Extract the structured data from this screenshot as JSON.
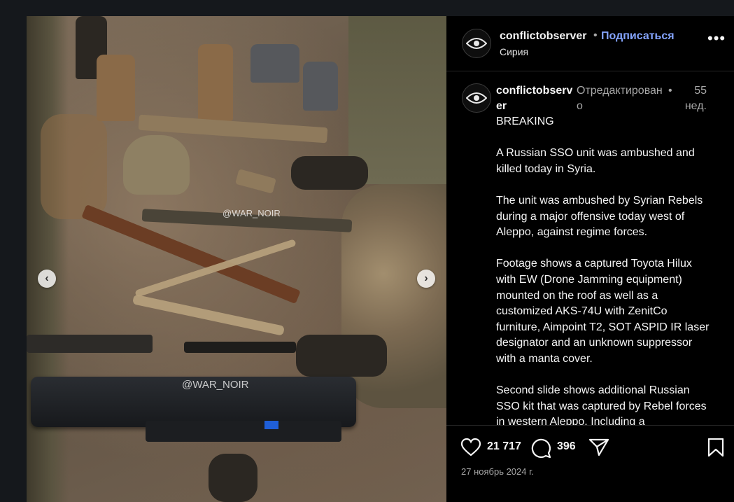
{
  "photo": {
    "watermark_1": "@WAR_NOIR",
    "watermark_2": "@WAR_NOIR",
    "prev_icon": "chevron-left-icon",
    "next_icon": "chevron-right-icon"
  },
  "header": {
    "username": "conflictobserver",
    "separator": "•",
    "follow_label": "Подписаться",
    "location": "Сирия",
    "more_label": "•••"
  },
  "caption": {
    "username": "conflictobserver",
    "edited_label": "Отредактировано",
    "separator": "•",
    "time_ago": "55 нед.",
    "text": "BREAKING\n\nA Russian SSO unit was ambushed and killed today in Syria.\n\nThe unit was ambushed by Syrian Rebels during a major offensive today west of Aleppo, against regime forces.\n\nFootage shows a captured Toyota Hilux with EW (Drone Jamming equipment) mounted on the roof as well as a customized AKS-74U with ZenitCo furniture, Aimpoint T2, SOT ASPID IR laser designator and an unknown suppressor with a manta cover.\n\nSecond slide shows additional Russian SSO kit that was captured by Rebel forces in western Aleppo. Including a"
  },
  "actions": {
    "likes_count": "21 717",
    "comments_count": "396",
    "date": "27 ноябрь 2024 г."
  },
  "colors": {
    "background": "#15181c",
    "panel": "#000000",
    "link": "#85a5ff",
    "muted": "#a8a8a8"
  }
}
